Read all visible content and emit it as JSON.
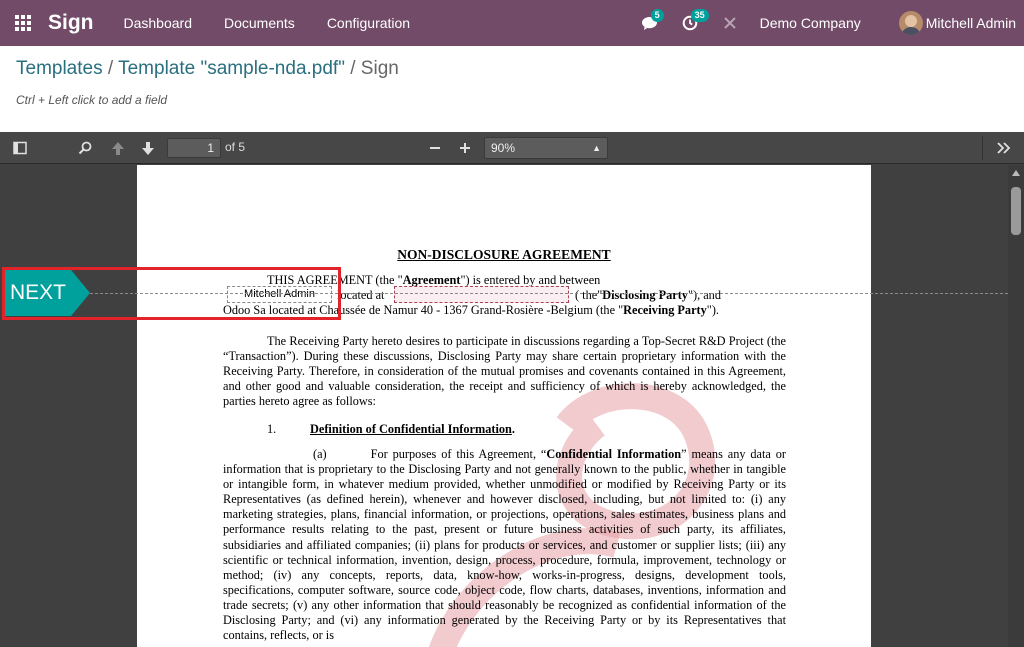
{
  "navbar": {
    "app_name": "Sign",
    "menu": [
      "Dashboard",
      "Documents",
      "Configuration"
    ],
    "messages_count": "5",
    "activities_count": "35",
    "company": "Demo Company",
    "user": "Mitchell Admin"
  },
  "breadcrumb": {
    "templates": "Templates",
    "sep1": " / ",
    "template": "Template \"sample-nda.pdf\"",
    "sep2": " / ",
    "current": "Sign"
  },
  "hint": "Ctrl + Left click to add a field",
  "viewer": {
    "page_number": "1",
    "page_of": "of 5",
    "zoom": "90%"
  },
  "document": {
    "title": "NON-DISCLOSURE AGREEMENT",
    "l1_a": "THIS AGREEMENT (the \"",
    "l1_b": "Agreement",
    "l1_c": "\") is entered by and between",
    "l2_a": "located at",
    "l2_b": "( the\"",
    "l2_c": "Disclosing Party",
    "l2_d": "\"), and",
    "l3_a": "Odoo Sa located at Chaussée de Namur 40 - 1367 Grand-Rosière  -Belgium (the \"",
    "l3_b": "Receiving Party",
    "l3_c": "\").",
    "p1": "The Receiving Party hereto desires to participate in discussions regarding a Top-Secret R&D Project (the “Transaction”).  During these discussions, Disclosing Party may share certain proprietary information with the Receiving Party.  Therefore, in consideration of the mutual promises and covenants contained in this Agreement, and other good and valuable consideration, the receipt and sufficiency of which is hereby acknowledged, the parties hereto agree as follows:",
    "s1_num": "1.",
    "s1_title": "Definition of Confidential Information",
    "s1_dot": ".",
    "p2_a": "(a)",
    "p2_b": "For purposes of this Agreement, “",
    "p2_c": "Confidential Information",
    "p2_d": "” means any data or information that is proprietary to the Disclosing Party and not generally known to the public, whether in tangible or intangible form, in whatever medium provided, whether unmodified or modified by Receiving Party or its Representatives (as defined herein), whenever and however disclosed, including, but not limited to: (i) any marketing strategies, plans, financial information, or projections, operations, sales estimates, business plans and performance results relating to the past, present or future business activities of such party, its affiliates, subsidiaries and affiliated companies; (ii) plans for products or services, and customer or supplier lists; (iii) any scientific or technical information, invention, design, process, procedure, formula, improvement, technology or method; (iv) any concepts, reports, data, know-how, works-in-progress, designs, development tools, specifications, computer software, source code, object code, flow charts, databases, inventions, information and trade secrets; (v) any other information that should reasonably be recognized as confidential information of the Disclosing Party; and (vi) any information generated by the Receiving Party or by its Representatives that contains, reflects, or is"
  },
  "fields": {
    "name_value": "Mitchell Admin"
  },
  "next_label": "NEXT",
  "colors": {
    "navbar": "#714b67",
    "next_arrow": "#00a09d",
    "highlight": "#e2242a"
  }
}
